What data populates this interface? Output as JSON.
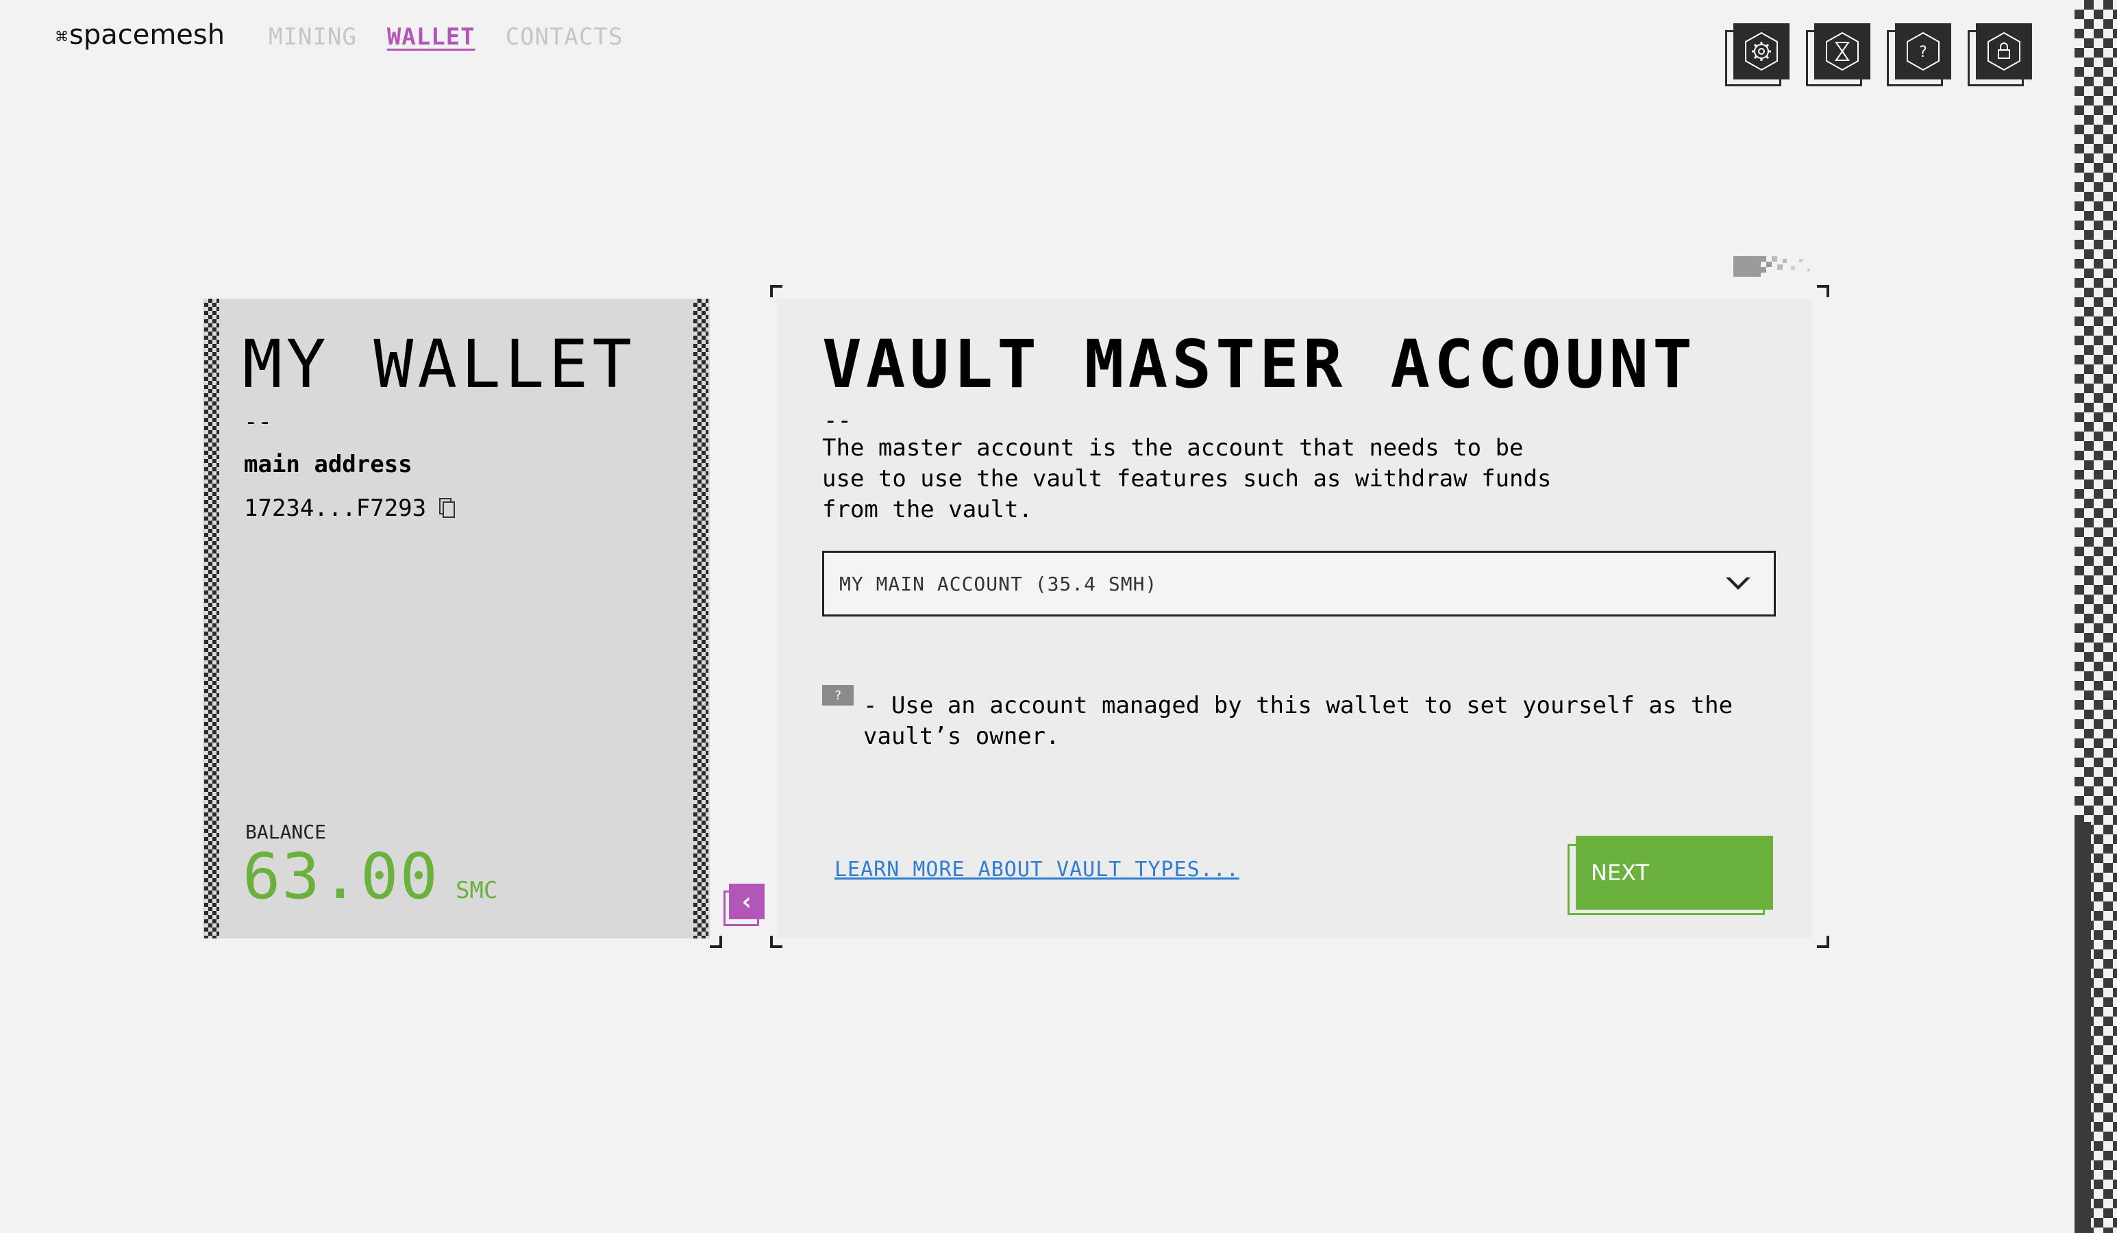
{
  "header": {
    "brand": "spacemesh",
    "nav": [
      {
        "label": "MINING",
        "active": false
      },
      {
        "label": "WALLET",
        "active": true
      },
      {
        "label": "CONTACTS",
        "active": false
      }
    ],
    "icons": [
      "settings-icon",
      "hourglass-icon",
      "help-icon",
      "lock-icon"
    ]
  },
  "wallet": {
    "title": "MY WALLET",
    "dash": "--",
    "address_label": "main address",
    "address": "17234...F7293",
    "balance_label": "BALANCE",
    "balance_value": "63.00",
    "balance_unit": "SMC"
  },
  "vault": {
    "title": "VAULT MASTER ACCOUNT",
    "dash": "--",
    "description": "The master account is the account that needs to be\nuse to use the vault features such as withdraw funds\nfrom the vault.",
    "dropdown_value": "MY MAIN ACCOUNT (35.4 SMH)",
    "hint_badge": "?",
    "hint_text": "- Use an account managed by this wallet to set yourself as the vault’s owner.",
    "learn_more": "LEARN MORE ABOUT VAULT TYPES...",
    "next_label": "NEXT"
  },
  "colors": {
    "accent_purple": "#b256b8",
    "accent_green": "#6bb13e",
    "link_blue": "#2f7dd1",
    "dark": "#2b2b2b"
  }
}
